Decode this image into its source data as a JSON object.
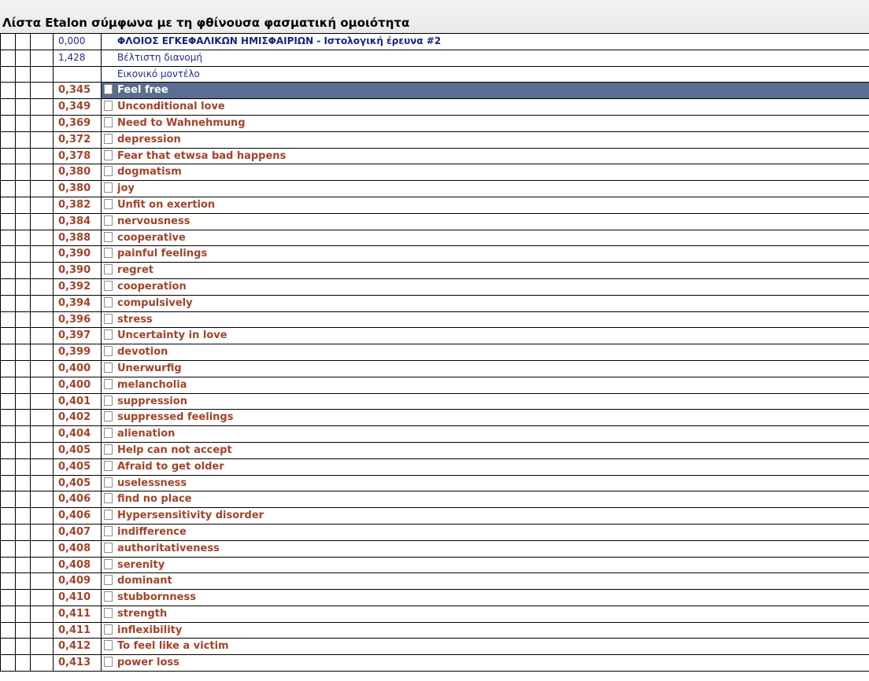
{
  "window": {
    "title": "Λίστα Etalon σύμφωνα με τη φθίνουσα φασματική ομοιότητα"
  },
  "header_rows": [
    {
      "value": "0,000",
      "label": "ΦΛΟΙΟΣ ΕΓΚΕΦΑΛΙΚΩΝ ΗΜΙΣΦΑΙΡΙΩΝ - Ιστολογική έρευνα #2",
      "bold": true
    },
    {
      "value": "1,428",
      "label": "Βέλτιστη διανομή",
      "bold": false
    },
    {
      "value": "",
      "label": "Εικονικό μοντέλο",
      "bold": false
    }
  ],
  "items": [
    {
      "value": "0,345",
      "label": "Feel free",
      "selected": true
    },
    {
      "value": "0,349",
      "label": "Unconditional love"
    },
    {
      "value": "0,369",
      "label": "Need to Wahnehmung"
    },
    {
      "value": "0,372",
      "label": "depression"
    },
    {
      "value": "0,378",
      "label": "Fear that etwsa bad happens"
    },
    {
      "value": "0,380",
      "label": "dogmatism"
    },
    {
      "value": "0,380",
      "label": "joy"
    },
    {
      "value": "0,382",
      "label": "Unfit on exertion"
    },
    {
      "value": "0,384",
      "label": "nervousness"
    },
    {
      "value": "0,388",
      "label": "cooperative"
    },
    {
      "value": "0,390",
      "label": "painful feelings"
    },
    {
      "value": "0,390",
      "label": "regret"
    },
    {
      "value": "0,392",
      "label": "cooperation"
    },
    {
      "value": "0,394",
      "label": "compulsively"
    },
    {
      "value": "0,396",
      "label": "stress"
    },
    {
      "value": "0,397",
      "label": "Uncertainty in love"
    },
    {
      "value": "0,399",
      "label": "devotion"
    },
    {
      "value": "0,400",
      "label": "Unerwurfig"
    },
    {
      "value": "0,400",
      "label": "melancholia"
    },
    {
      "value": "0,401",
      "label": "suppression"
    },
    {
      "value": "0,402",
      "label": "suppressed feelings"
    },
    {
      "value": "0,404",
      "label": "alienation"
    },
    {
      "value": "0,405",
      "label": "Help can not accept"
    },
    {
      "value": "0,405",
      "label": "Afraid to get older"
    },
    {
      "value": "0,405",
      "label": "uselessness"
    },
    {
      "value": "0,406",
      "label": "find no place"
    },
    {
      "value": "0,406",
      "label": "Hypersensitivity disorder"
    },
    {
      "value": "0,407",
      "label": "indifference"
    },
    {
      "value": "0,408",
      "label": "authoritativeness"
    },
    {
      "value": "0,408",
      "label": "serenity"
    },
    {
      "value": "0,409",
      "label": "dominant"
    },
    {
      "value": "0,410",
      "label": "stubbornness"
    },
    {
      "value": "0,411",
      "label": "strength"
    },
    {
      "value": "0,411",
      "label": "inflexibility"
    },
    {
      "value": "0,412",
      "label": "To feel like a victim"
    },
    {
      "value": "0,413",
      "label": "power loss"
    }
  ]
}
